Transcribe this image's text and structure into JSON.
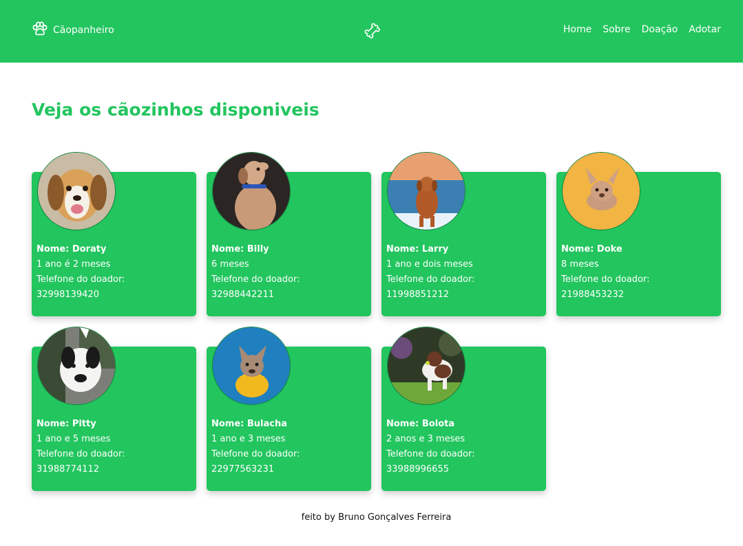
{
  "header": {
    "brand_icon": "paw-icon",
    "brand_name": "Cãopanheiro",
    "center_icon": "bone-icon",
    "nav": [
      "Home",
      "Sobre",
      "Doação",
      "Adotar"
    ]
  },
  "main": {
    "title": "Veja os cãozinhos disponiveis",
    "dogs": [
      {
        "name": "Nome: Doraty",
        "age": "1 ano é 2 meses",
        "phone_label": "Telefone do doador:",
        "phone": "32998139420"
      },
      {
        "name": "Nome: Billy",
        "age": "6 meses",
        "phone_label": "Telefone do doador:",
        "phone": "32988442211"
      },
      {
        "name": "Nome: Larry",
        "age": "1 ano e dois meses",
        "phone_label": "Telefone do doador:",
        "phone": "11998851212"
      },
      {
        "name": "Nome: Doke",
        "age": "8 meses",
        "phone_label": "Telefone do doador:",
        "phone": "21988453232"
      },
      {
        "name": "Nome: Pitty",
        "age": "1 ano e 5 meses",
        "phone_label": "Telefone do doador:",
        "phone": "31988774112"
      },
      {
        "name": "Nome: Bulacha",
        "age": "1 ano e 3 meses",
        "phone_label": "Telefone do doador:",
        "phone": "22977563231"
      },
      {
        "name": "Nome: Bolota",
        "age": "2 anos e 3 meses",
        "phone_label": "Telefone do doador:",
        "phone": "33988996655"
      }
    ]
  },
  "footer": {
    "credit": "feito by Bruno Gonçalves Ferreira"
  },
  "colors": {
    "brand_green": "#22c55e",
    "text_white": "#ffffff"
  }
}
